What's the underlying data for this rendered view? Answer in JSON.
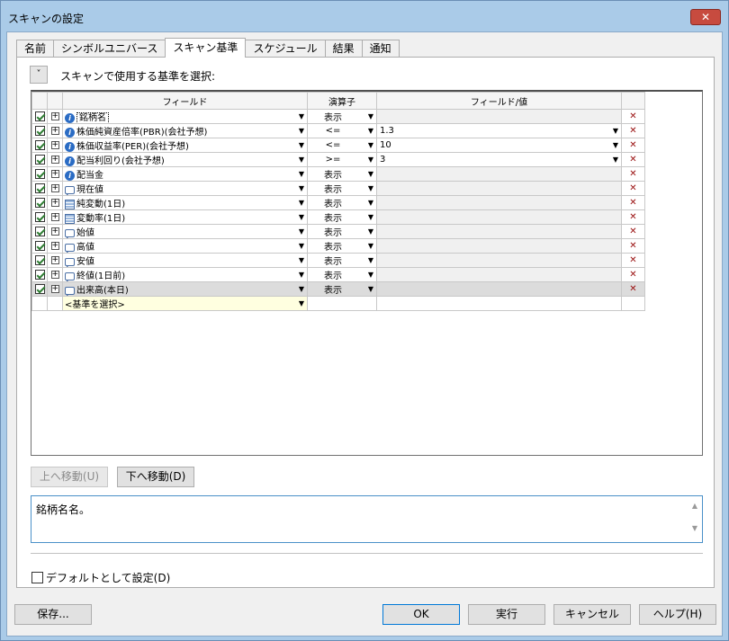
{
  "window": {
    "title": "スキャンの設定",
    "close_glyph": "✕"
  },
  "tabs": [
    "名前",
    "シンボルユニバース",
    "スキャン基準",
    "スケジュール",
    "結果",
    "通知"
  ],
  "active_tab": 2,
  "panel": {
    "collapse_glyph": "˅",
    "label": "スキャンで使用する基準を選択:"
  },
  "grid": {
    "headers": {
      "field": "フィールド",
      "operator": "演算子",
      "value": "フィールド/値"
    },
    "rows": [
      {
        "checked": true,
        "icon": "info-icon",
        "field": "銘柄名",
        "op": "表示",
        "value": ""
      },
      {
        "checked": true,
        "icon": "info-icon",
        "field": "株価純資産倍率(PBR)(会社予想)",
        "op": "<=",
        "value": "1.3"
      },
      {
        "checked": true,
        "icon": "info-icon",
        "field": "株価収益率(PER)(会社予想)",
        "op": "<=",
        "value": "10"
      },
      {
        "checked": true,
        "icon": "info-icon",
        "field": "配当利回り(会社予想)",
        "op": ">=",
        "value": "3"
      },
      {
        "checked": true,
        "icon": "info-icon",
        "field": "配当金",
        "op": "表示",
        "value": ""
      },
      {
        "checked": true,
        "icon": "quote-icon",
        "field": "現在値",
        "op": "表示",
        "value": ""
      },
      {
        "checked": true,
        "icon": "table-icon",
        "field": "純変動(1日)",
        "op": "表示",
        "value": ""
      },
      {
        "checked": true,
        "icon": "table-icon",
        "field": "変動率(1日)",
        "op": "表示",
        "value": ""
      },
      {
        "checked": true,
        "icon": "quote-icon",
        "field": "始値",
        "op": "表示",
        "value": ""
      },
      {
        "checked": true,
        "icon": "quote-icon",
        "field": "高値",
        "op": "表示",
        "value": ""
      },
      {
        "checked": true,
        "icon": "quote-icon",
        "field": "安値",
        "op": "表示",
        "value": ""
      },
      {
        "checked": true,
        "icon": "quote-icon",
        "field": "終値(1日前)",
        "op": "表示",
        "value": ""
      },
      {
        "checked": true,
        "icon": "quote-icon",
        "field": "出来高(本日)",
        "op": "表示",
        "value": ""
      }
    ],
    "new_row_placeholder": "<基準を選択>",
    "plus_glyph": "+",
    "dropdown_glyph": "▼",
    "delete_glyph": "✕"
  },
  "buttons": {
    "move_up": "上へ移動(U)",
    "move_down": "下へ移動(D)",
    "save": "保存...",
    "ok": "OK",
    "run": "実行",
    "cancel": "キャンセル",
    "help": "ヘルプ(H)"
  },
  "description": {
    "text": "銘柄名名。",
    "scroll_up": "▲",
    "scroll_down": "▼"
  },
  "default_checkbox": {
    "label": "デフォルトとして設定(D)",
    "checked": false
  }
}
